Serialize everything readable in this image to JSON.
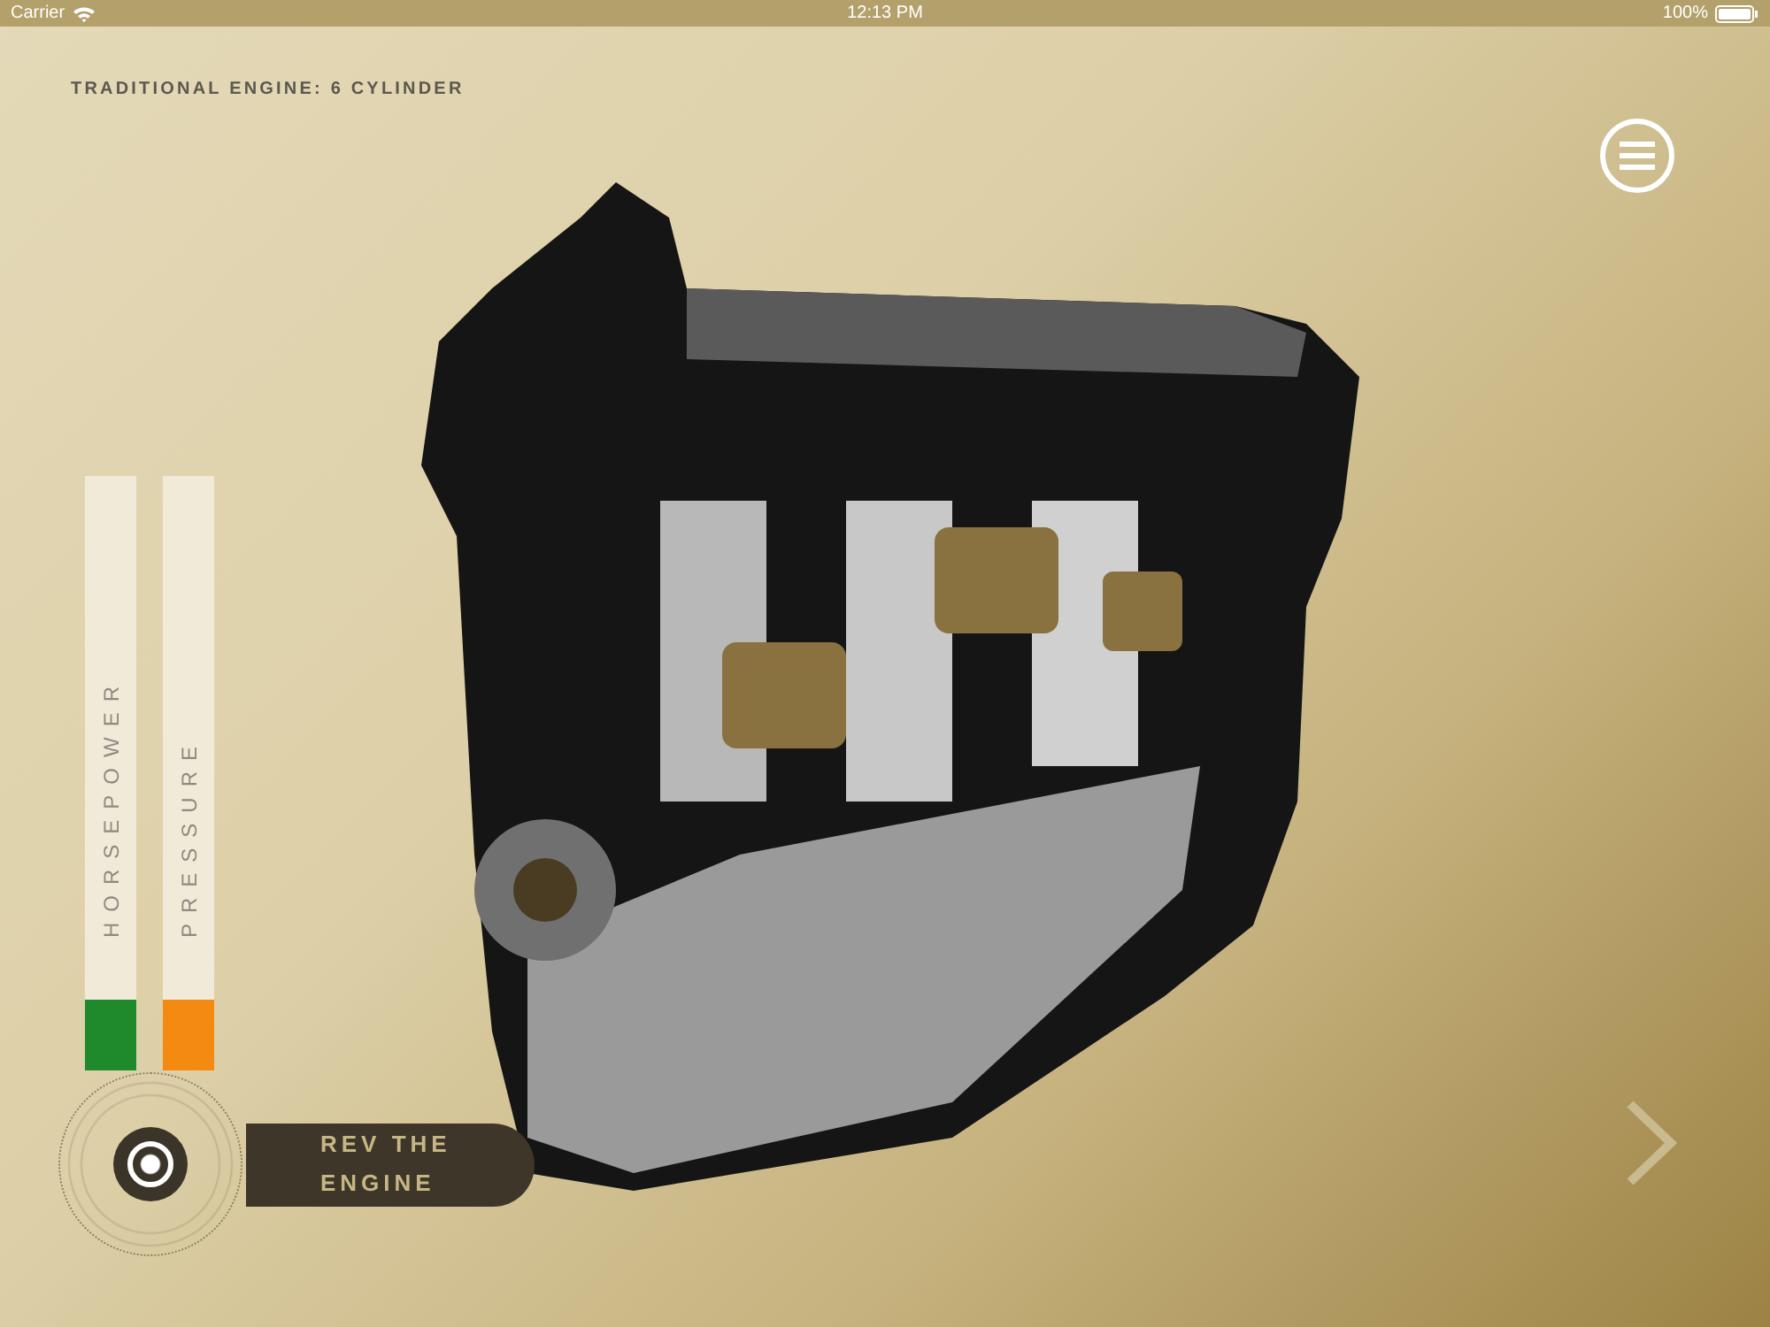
{
  "status_bar": {
    "carrier": "Carrier",
    "time": "12:13 PM",
    "battery": "100%"
  },
  "title": "TRADITIONAL ENGINE: 6 CYLINDER",
  "gauges": [
    {
      "label": "HORSEPOWER",
      "level": 0.12,
      "color": "#1e8a2c"
    },
    {
      "label": "PRESSURE",
      "level": 0.12,
      "color": "#f58a12"
    }
  ],
  "rev_button": {
    "label": "REV THE ENGINE"
  }
}
